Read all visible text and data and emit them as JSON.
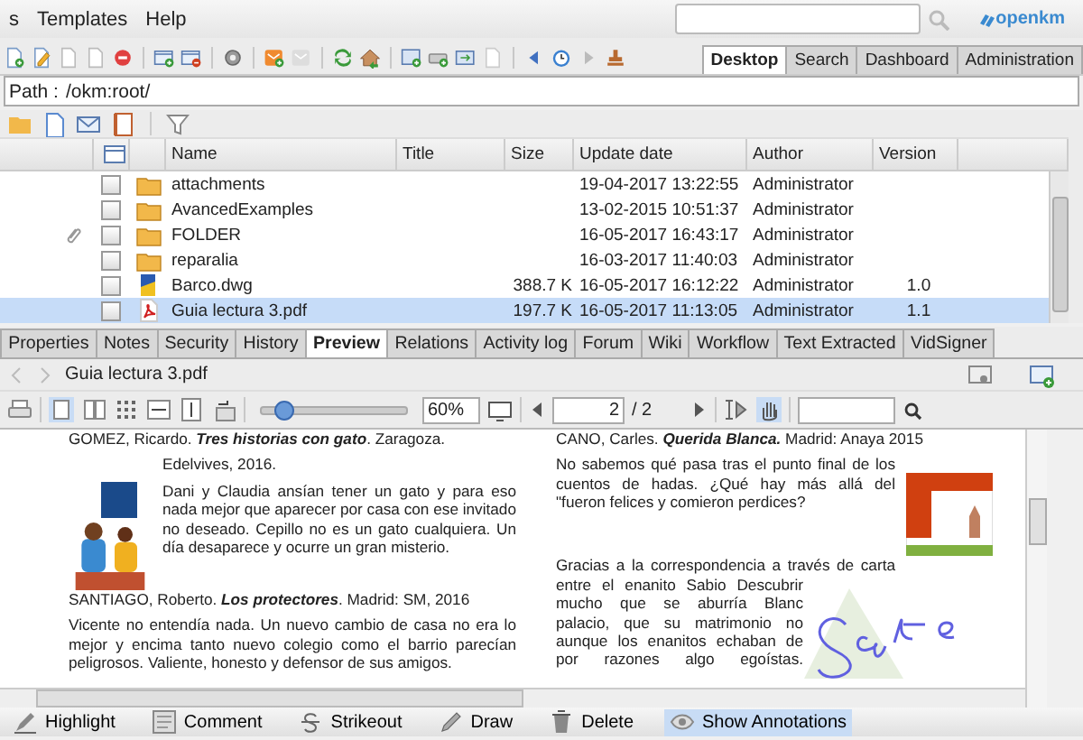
{
  "menu": [
    "s",
    "Templates",
    "Help"
  ],
  "logo": "openkm",
  "main_tabs": [
    {
      "label": "Desktop",
      "selected": true
    },
    {
      "label": "Search",
      "selected": false
    },
    {
      "label": "Dashboard",
      "selected": false
    },
    {
      "label": "Administration",
      "selected": false
    }
  ],
  "path": {
    "label": "Path :",
    "value": "/okm:root/"
  },
  "table": {
    "columns": [
      "Name",
      "Title",
      "Size",
      "Update date",
      "Author",
      "Version"
    ],
    "rows": [
      {
        "kind": "folder",
        "name": "attachments",
        "size": "",
        "date": "19-04-2017 13:22:55",
        "author": "Administrator",
        "version": "",
        "attachment": false,
        "checked": false,
        "selected": false
      },
      {
        "kind": "folder",
        "name": "AvancedExamples",
        "size": "",
        "date": "13-02-2015 10:51:37",
        "author": "Administrator",
        "version": "",
        "attachment": false,
        "checked": false,
        "selected": false
      },
      {
        "kind": "folder",
        "name": "FOLDER",
        "size": "",
        "date": "16-05-2017 16:43:17",
        "author": "Administrator",
        "version": "",
        "attachment": true,
        "checked": false,
        "selected": false
      },
      {
        "kind": "folder",
        "name": "reparalia",
        "size": "",
        "date": "16-03-2017 11:40:03",
        "author": "Administrator",
        "version": "",
        "attachment": false,
        "checked": false,
        "selected": false
      },
      {
        "kind": "drawing",
        "name": "Barco.dwg",
        "size": "388.7 K",
        "date": "16-05-2017 16:12:22",
        "author": "Administrator",
        "version": "1.0",
        "attachment": false,
        "checked": false,
        "selected": false
      },
      {
        "kind": "pdf",
        "name": "Guia lectura 3.pdf",
        "size": "197.7 K",
        "date": "16-05-2017 11:13:05",
        "author": "Administrator",
        "version": "1.1",
        "attachment": false,
        "checked": false,
        "selected": true
      }
    ]
  },
  "doc_tabs": [
    {
      "label": "Properties",
      "selected": false
    },
    {
      "label": "Notes",
      "selected": false
    },
    {
      "label": "Security",
      "selected": false
    },
    {
      "label": "History",
      "selected": false
    },
    {
      "label": "Preview",
      "selected": true
    },
    {
      "label": "Relations",
      "selected": false
    },
    {
      "label": "Activity log",
      "selected": false
    },
    {
      "label": "Forum",
      "selected": false
    },
    {
      "label": "Wiki",
      "selected": false
    },
    {
      "label": "Workflow",
      "selected": false
    },
    {
      "label": "Text Extracted",
      "selected": false
    },
    {
      "label": "VidSigner",
      "selected": false
    }
  ],
  "viewer": {
    "filename": "Guia lectura 3.pdf",
    "zoom": "60%",
    "zoom_slider": {
      "level": 0.15
    },
    "page": "2",
    "page_total": "/ 2"
  },
  "document": {
    "left": [
      {
        "kind": "reference",
        "text": "GOMEZ, Ricardo. **Tres historias con gato**. Zaragoza."
      },
      {
        "kind": "continuation",
        "text": "Edelvives, 2016."
      },
      {
        "kind": "illustrated",
        "text": "Dani y Claudia ansían tener un gato y para eso nada mejor que aparecer por casa con ese invitado no deseado. Cepillo no es un gato cualquiera. Un día desaparece y ocurre un gran misterio."
      },
      {
        "kind": "reference",
        "text": "SANTIAGO, Roberto. **Los protectores**. Madrid: SM, 2016"
      },
      {
        "kind": "paragraph",
        "text": "Vicente no entendía nada. Un nuevo cambio de casa no era lo mejor  y encima tanto nuevo colegio como el barrio parecían peligrosos. Valiente, honesto y defensor de sus amigos."
      }
    ],
    "right": [
      {
        "kind": "reference",
        "text": "CANO, Carles. **Querida Blanca.** Madrid: Anaya 2015"
      },
      {
        "kind": "cover",
        "text": "No sabemos qué pasa tras el punto final de los cuentos de hadas. ¿Qué hay más allá del \"fueron felices y comieron perdices?"
      },
      {
        "kind": "signed",
        "lines": [
          "Gracias a la correspondencia a través de carta",
          "entre el enanito Sabio  Descubrir",
          "mucho que se aburría Blanc",
          "palacio, que su matrimonio no",
          "aunque los enanitos echaban de",
          "por razones algo egoístas."
        ]
      }
    ]
  },
  "annotation_tools": [
    {
      "kind": "highlight",
      "label": "Highlight",
      "on": false
    },
    {
      "kind": "comment",
      "label": "Comment",
      "on": false
    },
    {
      "kind": "strikeout",
      "label": "Strikeout",
      "on": false
    },
    {
      "kind": "draw",
      "label": "Draw",
      "on": false
    },
    {
      "kind": "delete",
      "label": "Delete",
      "on": false
    },
    {
      "kind": "eye",
      "label": "Show Annotations",
      "on": true
    }
  ]
}
